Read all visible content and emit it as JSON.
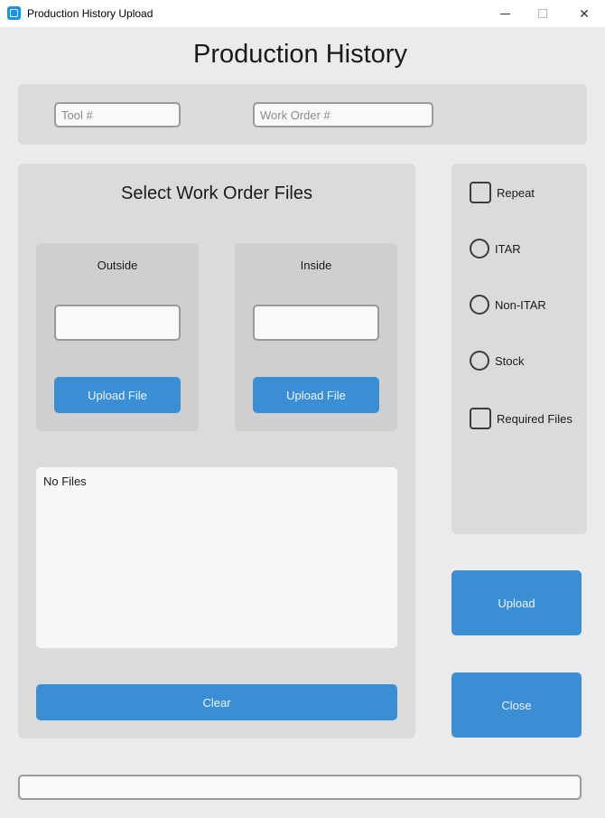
{
  "window": {
    "title": "Production History Upload",
    "minimize_glyph": "",
    "maximize_glyph": "",
    "close_glyph": "✕"
  },
  "header": {
    "title": "Production History"
  },
  "inputs": {
    "tool_placeholder": "Tool #",
    "work_order_placeholder": "Work Order #"
  },
  "files_section": {
    "title": "Select Work Order Files",
    "outside": {
      "label": "Outside",
      "value": "",
      "button": "Upload File"
    },
    "inside": {
      "label": "Inside",
      "value": "",
      "button": "Upload File"
    },
    "file_list_text": "No Files",
    "clear_button": "Clear"
  },
  "options": {
    "repeat": {
      "label": "Repeat",
      "checked": false
    },
    "itar": {
      "label": "ITAR",
      "selected": false
    },
    "non_itar": {
      "label": "Non-ITAR",
      "selected": false
    },
    "stock": {
      "label": "Stock",
      "selected": false
    },
    "required_files": {
      "label": "Required Files",
      "checked": false
    }
  },
  "actions": {
    "upload": "Upload",
    "close": "Close"
  },
  "status": {
    "value": ""
  },
  "colors": {
    "accent": "#3a8ed4",
    "panel": "#dbdbdb",
    "sub_panel": "#cfcfcf",
    "background": "#ebebeb"
  }
}
